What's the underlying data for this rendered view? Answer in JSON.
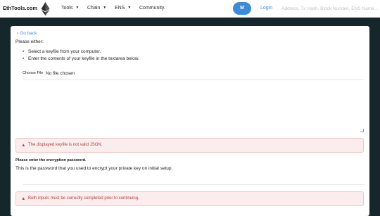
{
  "navbar": {
    "brand": "EthTools.com",
    "logo": "ethereum-diamond-icon",
    "items": [
      {
        "label": "Tools",
        "has_dropdown": true
      },
      {
        "label": "Chain",
        "has_dropdown": true
      },
      {
        "label": "ENS",
        "has_dropdown": true
      },
      {
        "label": "Community.",
        "has_dropdown": false
      }
    ],
    "account_button": "M",
    "login": "Login",
    "search_placeholder": "Address, Tx Hash, Block Number, ENS Name..."
  },
  "form": {
    "back_link": "Go back",
    "intro": "Please either:",
    "options": [
      "Select a keyfile from your computer.",
      "Enter the contents of your keyfile in the textarea below."
    ],
    "file_button": "Choose File",
    "file_status": "No file chosen",
    "keyfile_textarea_value": "",
    "keyfile_error": "The displayed keyfile is not valid JSON.",
    "password_label": "Please enter the encryption password.",
    "password_description": "This is the password that you used to encrypt your private key on initial setup.",
    "password_value": "",
    "submit_error": "Both inputs must be correctly completed prior to continuing."
  },
  "colors": {
    "page_background": "#15272b",
    "accent": "#3d8bd8",
    "error_text": "#a94442",
    "error_background": "#fbeded"
  }
}
